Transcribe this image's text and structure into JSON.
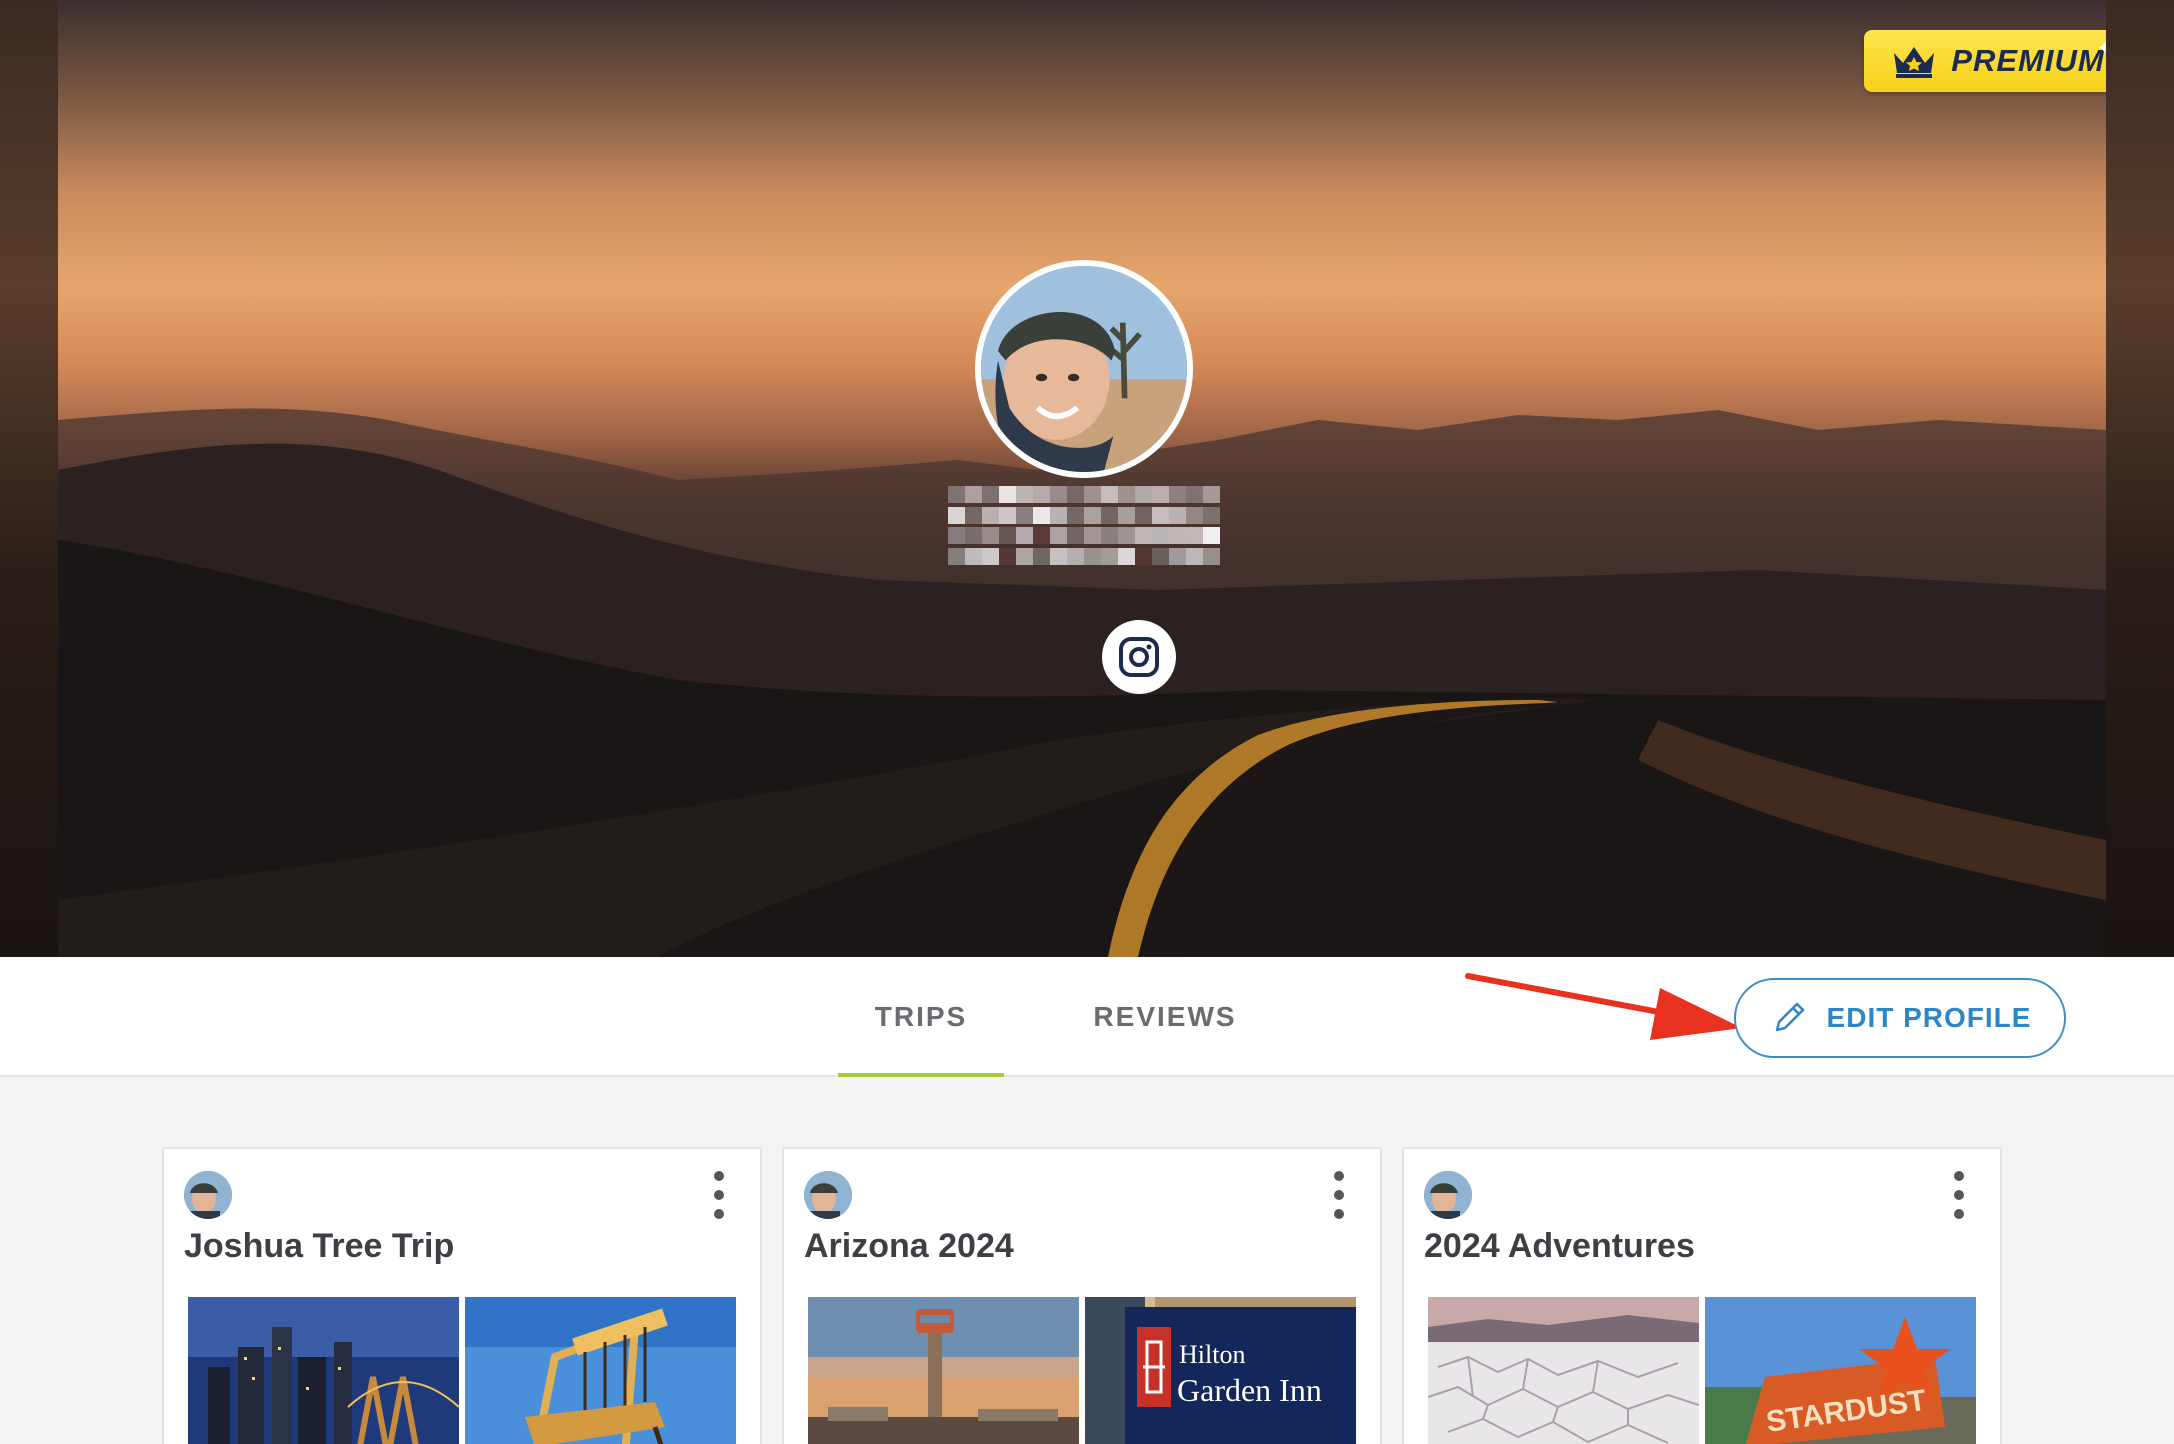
{
  "hero": {
    "premium_label": "PREMIUM",
    "username_obscured": true,
    "social": {
      "icon": "instagram-icon"
    }
  },
  "tabs": [
    {
      "label": "TRIPS",
      "active": true
    },
    {
      "label": "REVIEWS",
      "active": false
    }
  ],
  "actions": {
    "edit_profile_label": "EDIT PROFILE",
    "edit_icon": "pencil-icon"
  },
  "colors": {
    "premium_bg": "#f6d21c",
    "premium_text": "#1d2b4f",
    "accent_blue": "#2f86c4",
    "active_tab_underline": "#a9cb3a",
    "annotation_arrow": "#e8321f"
  },
  "trips": [
    {
      "title": "Joshua Tree Trip",
      "thumbs": [
        "city-skyline-night",
        "giant-chair"
      ]
    },
    {
      "title": "Arizona 2024",
      "thumbs": [
        "airport-control-tower",
        "hilton-garden-inn-sign"
      ]
    },
    {
      "title": "2024 Adventures",
      "thumbs": [
        "salt-flats",
        "neon-sign-stardust"
      ]
    }
  ],
  "thumb_text": {
    "hilton_line1": "Hilton",
    "hilton_line2": "Garden Inn",
    "stardust": "STARDUST"
  }
}
